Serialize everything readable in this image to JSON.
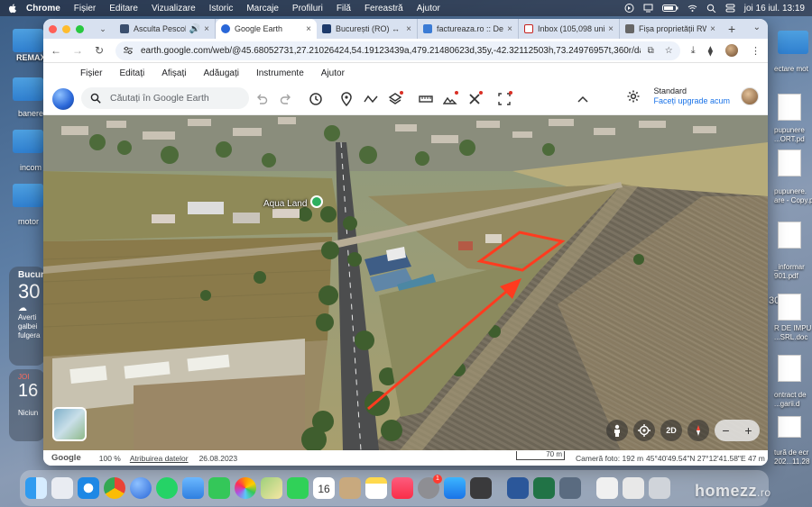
{
  "menubar": {
    "app": "Chrome",
    "items": [
      "Fișier",
      "Editare",
      "Vizualizare",
      "Istoric",
      "Marcaje",
      "Profiluri",
      "Filă",
      "Fereastră",
      "Ajutor"
    ],
    "datetime": "joi 16 iul.  13:19"
  },
  "desktop": {
    "left_labels": [
      "REMAX",
      "banere",
      "incom",
      "motor"
    ],
    "weather": {
      "city": "Bucur",
      "temp": "30",
      "alert": "Averti galbei fulgera"
    },
    "calendar": {
      "day": "JOI",
      "date": "16",
      "note": "Niciun"
    },
    "right_labels": [
      "ectare mot",
      "pupunere ...ORT.pd",
      "pupunere. are - Copy.p",
      "_informar 901.pdf",
      "30",
      "R DE IMPU ...SRL.doc",
      "ontract de ...garii.d",
      "tură de ecr 202...11.28"
    ]
  },
  "browser": {
    "tabs": [
      {
        "title": "Asculta Pescob",
        "color": "#3b4f6e",
        "active": false,
        "audio": true
      },
      {
        "title": "Google Earth",
        "color": "#2a67d8",
        "active": true,
        "audio": false
      },
      {
        "title": "București (RO) ↔ D",
        "color": "#1d3a6b",
        "active": false,
        "audio": false
      },
      {
        "title": "factureaza.ro :: De",
        "color": "#3a7bd5",
        "active": false,
        "audio": false
      },
      {
        "title": "Inbox (105,098 uni",
        "color": "#c5221f",
        "active": false,
        "audio": false
      },
      {
        "title": "Fișa proprietății RW",
        "color": "#666666",
        "active": false,
        "audio": false
      }
    ],
    "url": "earth.google.com/web/@45.68052731,27.21026424,54.19123439a,479.21480623d,35y,-42.32112503h,73.24976957t,360r/data=C..."
  },
  "earth": {
    "menu": [
      "Fișier",
      "Editați",
      "Afișați",
      "Adăugați",
      "Instrumente",
      "Ajutor"
    ],
    "search_placeholder": "Căutați în Google Earth",
    "account": {
      "plan": "Standard",
      "upgrade": "Faceți upgrade acum"
    },
    "place_label": "Aqua Land",
    "controls": {
      "mode": "2D"
    },
    "status": {
      "brand": "Google",
      "zoom": "100 %",
      "attribution": "Atribuirea datelor",
      "date": "26.08.2023",
      "scale": "70 m",
      "camera": "Cameră foto: 192 m",
      "coords": "45°40'49.54\"N 27°12'41.58\"E  47 m"
    }
  },
  "watermark": {
    "brand": "homezz",
    "tld": ".ro"
  }
}
